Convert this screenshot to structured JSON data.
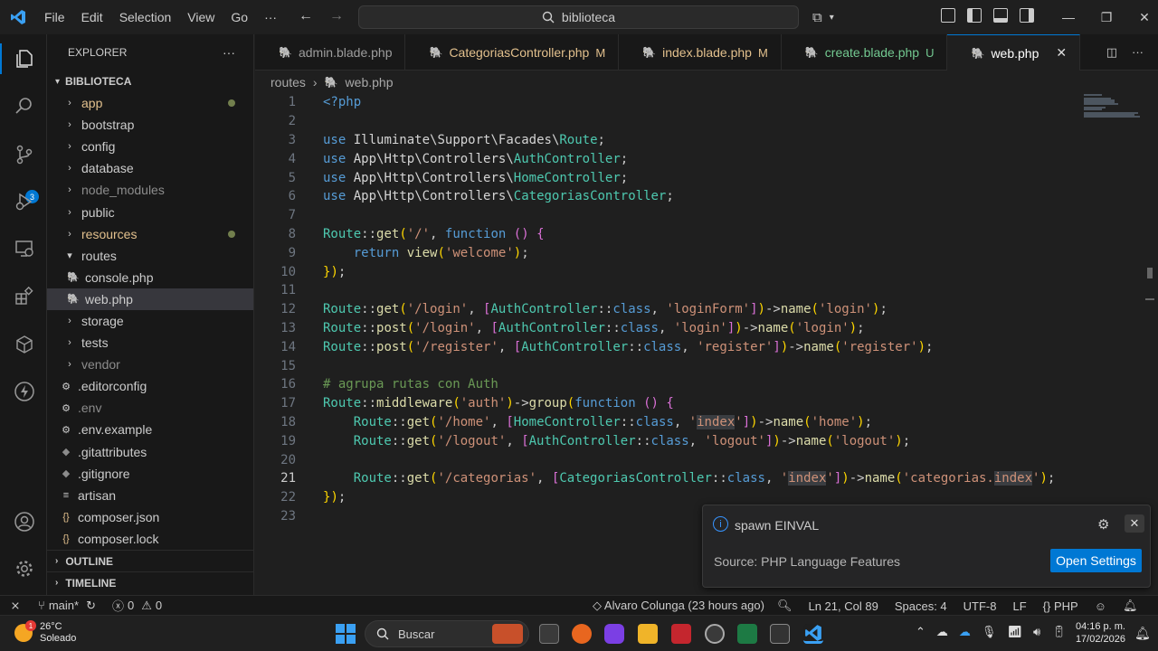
{
  "menu": [
    "File",
    "Edit",
    "Selection",
    "View",
    "Go",
    "···"
  ],
  "command_center": "biblioteca",
  "explorer": {
    "title": "EXPLORER",
    "more": "···",
    "root": "BIBLIOTECA",
    "items": [
      {
        "label": "app",
        "type": "folder",
        "color": "#e2c08d",
        "dot": true
      },
      {
        "label": "bootstrap",
        "type": "folder",
        "color": "#cccccc"
      },
      {
        "label": "config",
        "type": "folder",
        "color": "#cccccc"
      },
      {
        "label": "database",
        "type": "folder",
        "color": "#cccccc"
      },
      {
        "label": "node_modules",
        "type": "folder",
        "color": "#8c8c8c"
      },
      {
        "label": "public",
        "type": "folder",
        "color": "#cccccc"
      },
      {
        "label": "resources",
        "type": "folder",
        "color": "#e2c08d",
        "dot": true
      },
      {
        "label": "routes",
        "type": "folder-open",
        "color": "#cccccc"
      },
      {
        "label": "console.php",
        "type": "php",
        "color": "#cccccc"
      },
      {
        "label": "web.php",
        "type": "php",
        "color": "#cccccc",
        "selected": true
      },
      {
        "label": "storage",
        "type": "folder",
        "color": "#cccccc"
      },
      {
        "label": "tests",
        "type": "folder",
        "color": "#cccccc"
      },
      {
        "label": "vendor",
        "type": "folder",
        "color": "#8c8c8c"
      },
      {
        "label": ".editorconfig",
        "type": "gear",
        "color": "#cccccc"
      },
      {
        "label": ".env",
        "type": "gear",
        "color": "#8c8c8c"
      },
      {
        "label": ".env.example",
        "type": "gear",
        "color": "#cccccc"
      },
      {
        "label": ".gitattributes",
        "type": "git",
        "color": "#cccccc"
      },
      {
        "label": ".gitignore",
        "type": "git",
        "color": "#cccccc"
      },
      {
        "label": "artisan",
        "type": "lines",
        "color": "#cccccc"
      },
      {
        "label": "composer.json",
        "type": "json",
        "color": "#cccccc"
      },
      {
        "label": "composer.lock",
        "type": "json",
        "color": "#cccccc"
      }
    ],
    "outline": "OUTLINE",
    "timeline": "TIMELINE"
  },
  "scm_badge": "3",
  "tabs": [
    {
      "label": "admin.blade.php",
      "status": "",
      "cls": ""
    },
    {
      "label": "CategoriasController.php",
      "status": "M",
      "cls": "tname-mod"
    },
    {
      "label": "index.blade.php",
      "status": "M",
      "cls": "tname-mod"
    },
    {
      "label": "create.blade.php",
      "status": "U",
      "cls": "tname-untr"
    },
    {
      "label": "web.php",
      "status": "",
      "cls": "",
      "active": true
    }
  ],
  "breadcrumb": {
    "folder": "routes",
    "file": "web.php"
  },
  "code": {
    "current_line": 21,
    "lines": [
      "<?php",
      "",
      "use Illuminate\\Support\\Facades\\Route;",
      "use App\\Http\\Controllers\\AuthController;",
      "use App\\Http\\Controllers\\HomeController;",
      "use App\\Http\\Controllers\\CategoriasController;",
      "",
      "Route::get('/', function () {",
      "    return view('welcome');",
      "});",
      "",
      "Route::get('/login', [AuthController::class, 'loginForm'])->name('login');",
      "Route::post('/login', [AuthController::class, 'login'])->name('login');",
      "Route::post('/register', [AuthController::class, 'register'])->name('register');",
      "",
      "# agrupa rutas con Auth",
      "Route::middleware('auth')->group(function () {",
      "    Route::get('/home', [HomeController::class, 'index'])->name('home');",
      "    Route::get('/logout', [AuthController::class, 'logout'])->name('logout');",
      "",
      "    Route::get('/categorias', [CategoriasController::class, 'index'])->name('categorias.index');",
      "});",
      ""
    ]
  },
  "notification": {
    "message": "spawn EINVAL",
    "source": "Source: PHP Language Features",
    "button": "Open Settings"
  },
  "status": {
    "branch": "main*",
    "errors": "0",
    "warnings": "0",
    "blame": "Alvaro Colunga (23 hours ago)",
    "position": "Ln 21, Col 89",
    "spaces": "Spaces: 4",
    "encoding": "UTF-8",
    "eol": "LF",
    "language": "PHP"
  },
  "taskbar": {
    "weather_temp": "26°C",
    "weather_desc": "Soleado",
    "weather_badge": "1",
    "search": "Buscar",
    "time": "04:16 p. m.",
    "date": "17/02/2026"
  }
}
